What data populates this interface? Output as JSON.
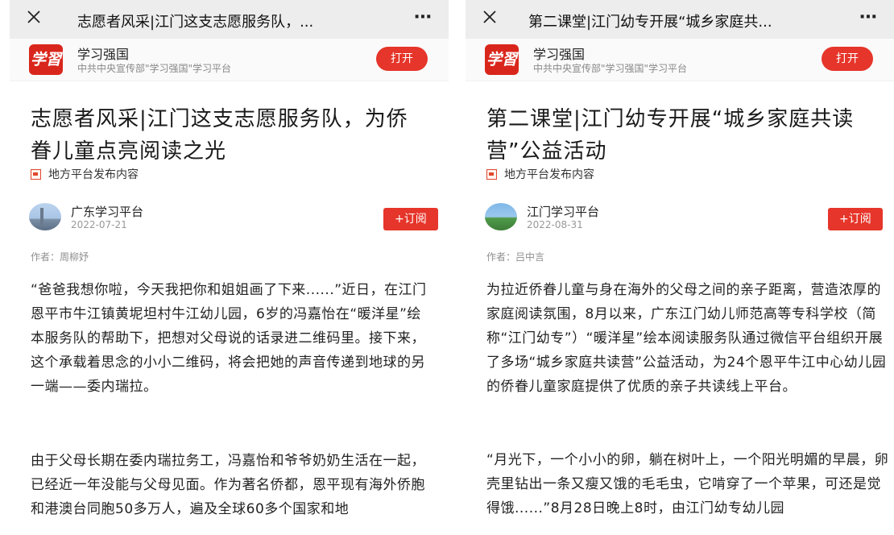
{
  "app": {
    "name": "学习强国",
    "description": "中共中央宣传部\"学习强国\"学习平台",
    "logo_text": "学習",
    "open_label": "打开",
    "more_icon": "⋯",
    "brand_color": "#e6352a"
  },
  "left": {
    "window_title": "志愿者风采|江门这支志愿服务队，...",
    "article_title": "志愿者风采|江门这支志愿服务队，为侨眷儿童点亮阅读之光",
    "source_tag": "地方平台发布内容",
    "channel": "广东学习平台",
    "date": "2022-07-21",
    "subscribe_label": "+订阅",
    "author": "作者：周柳妤",
    "paragraphs": [
      "“爸爸我想你啦，今天我把你和姐姐画了下来......”近日，在江门恩平市牛江镇黄坭坦村牛江幼儿园，6岁的冯嘉怡在“暖洋星”绘本服务队的帮助下，把想对父母说的话录进二维码里。接下来，这个承载着思念的小小二维码，将会把她的声音传递到地球的另一端——委内瑞拉。",
      "由于父母长期在委内瑞拉务工，冯嘉怡和爷爷奶奶生活在一起，已经近一年没能与父母见面。作为著名侨都，恩平现有海外侨胞和港澳台同胞50多万人，遍及全球60多个国家和地"
    ]
  },
  "right": {
    "window_title": "第二课堂|江门幼专开展“城乡家庭共...",
    "article_title": "第二课堂|江门幼专开展“城乡家庭共读营”公益活动",
    "source_tag": "地方平台发布内容",
    "channel": "江门学习平台",
    "date": "2022-08-31",
    "subscribe_label": "+订阅",
    "author": "作者：吕中言",
    "paragraphs": [
      "为拉近侨眷儿童与身在海外的父母之间的亲子距离，营造浓厚的家庭阅读氛围，8月以来，广东江门幼儿师范高等专科学校（简称“江门幼专”）“暖洋星”绘本阅读服务队通过微信平台组织开展了多场“城乡家庭共读营”公益活动，为24个恩平牛江中心幼儿园的侨眷儿童家庭提供了优质的亲子共读线上平台。",
      "“月光下，一个小小的卵，躺在树叶上，一个阳光明媚的早晨，卵壳里钻出一条又瘦又饿的毛毛虫，它啃穿了一个苹果，可还是觉得饿......”8月28日晚上8时，由江门幼专幼儿园"
    ]
  }
}
